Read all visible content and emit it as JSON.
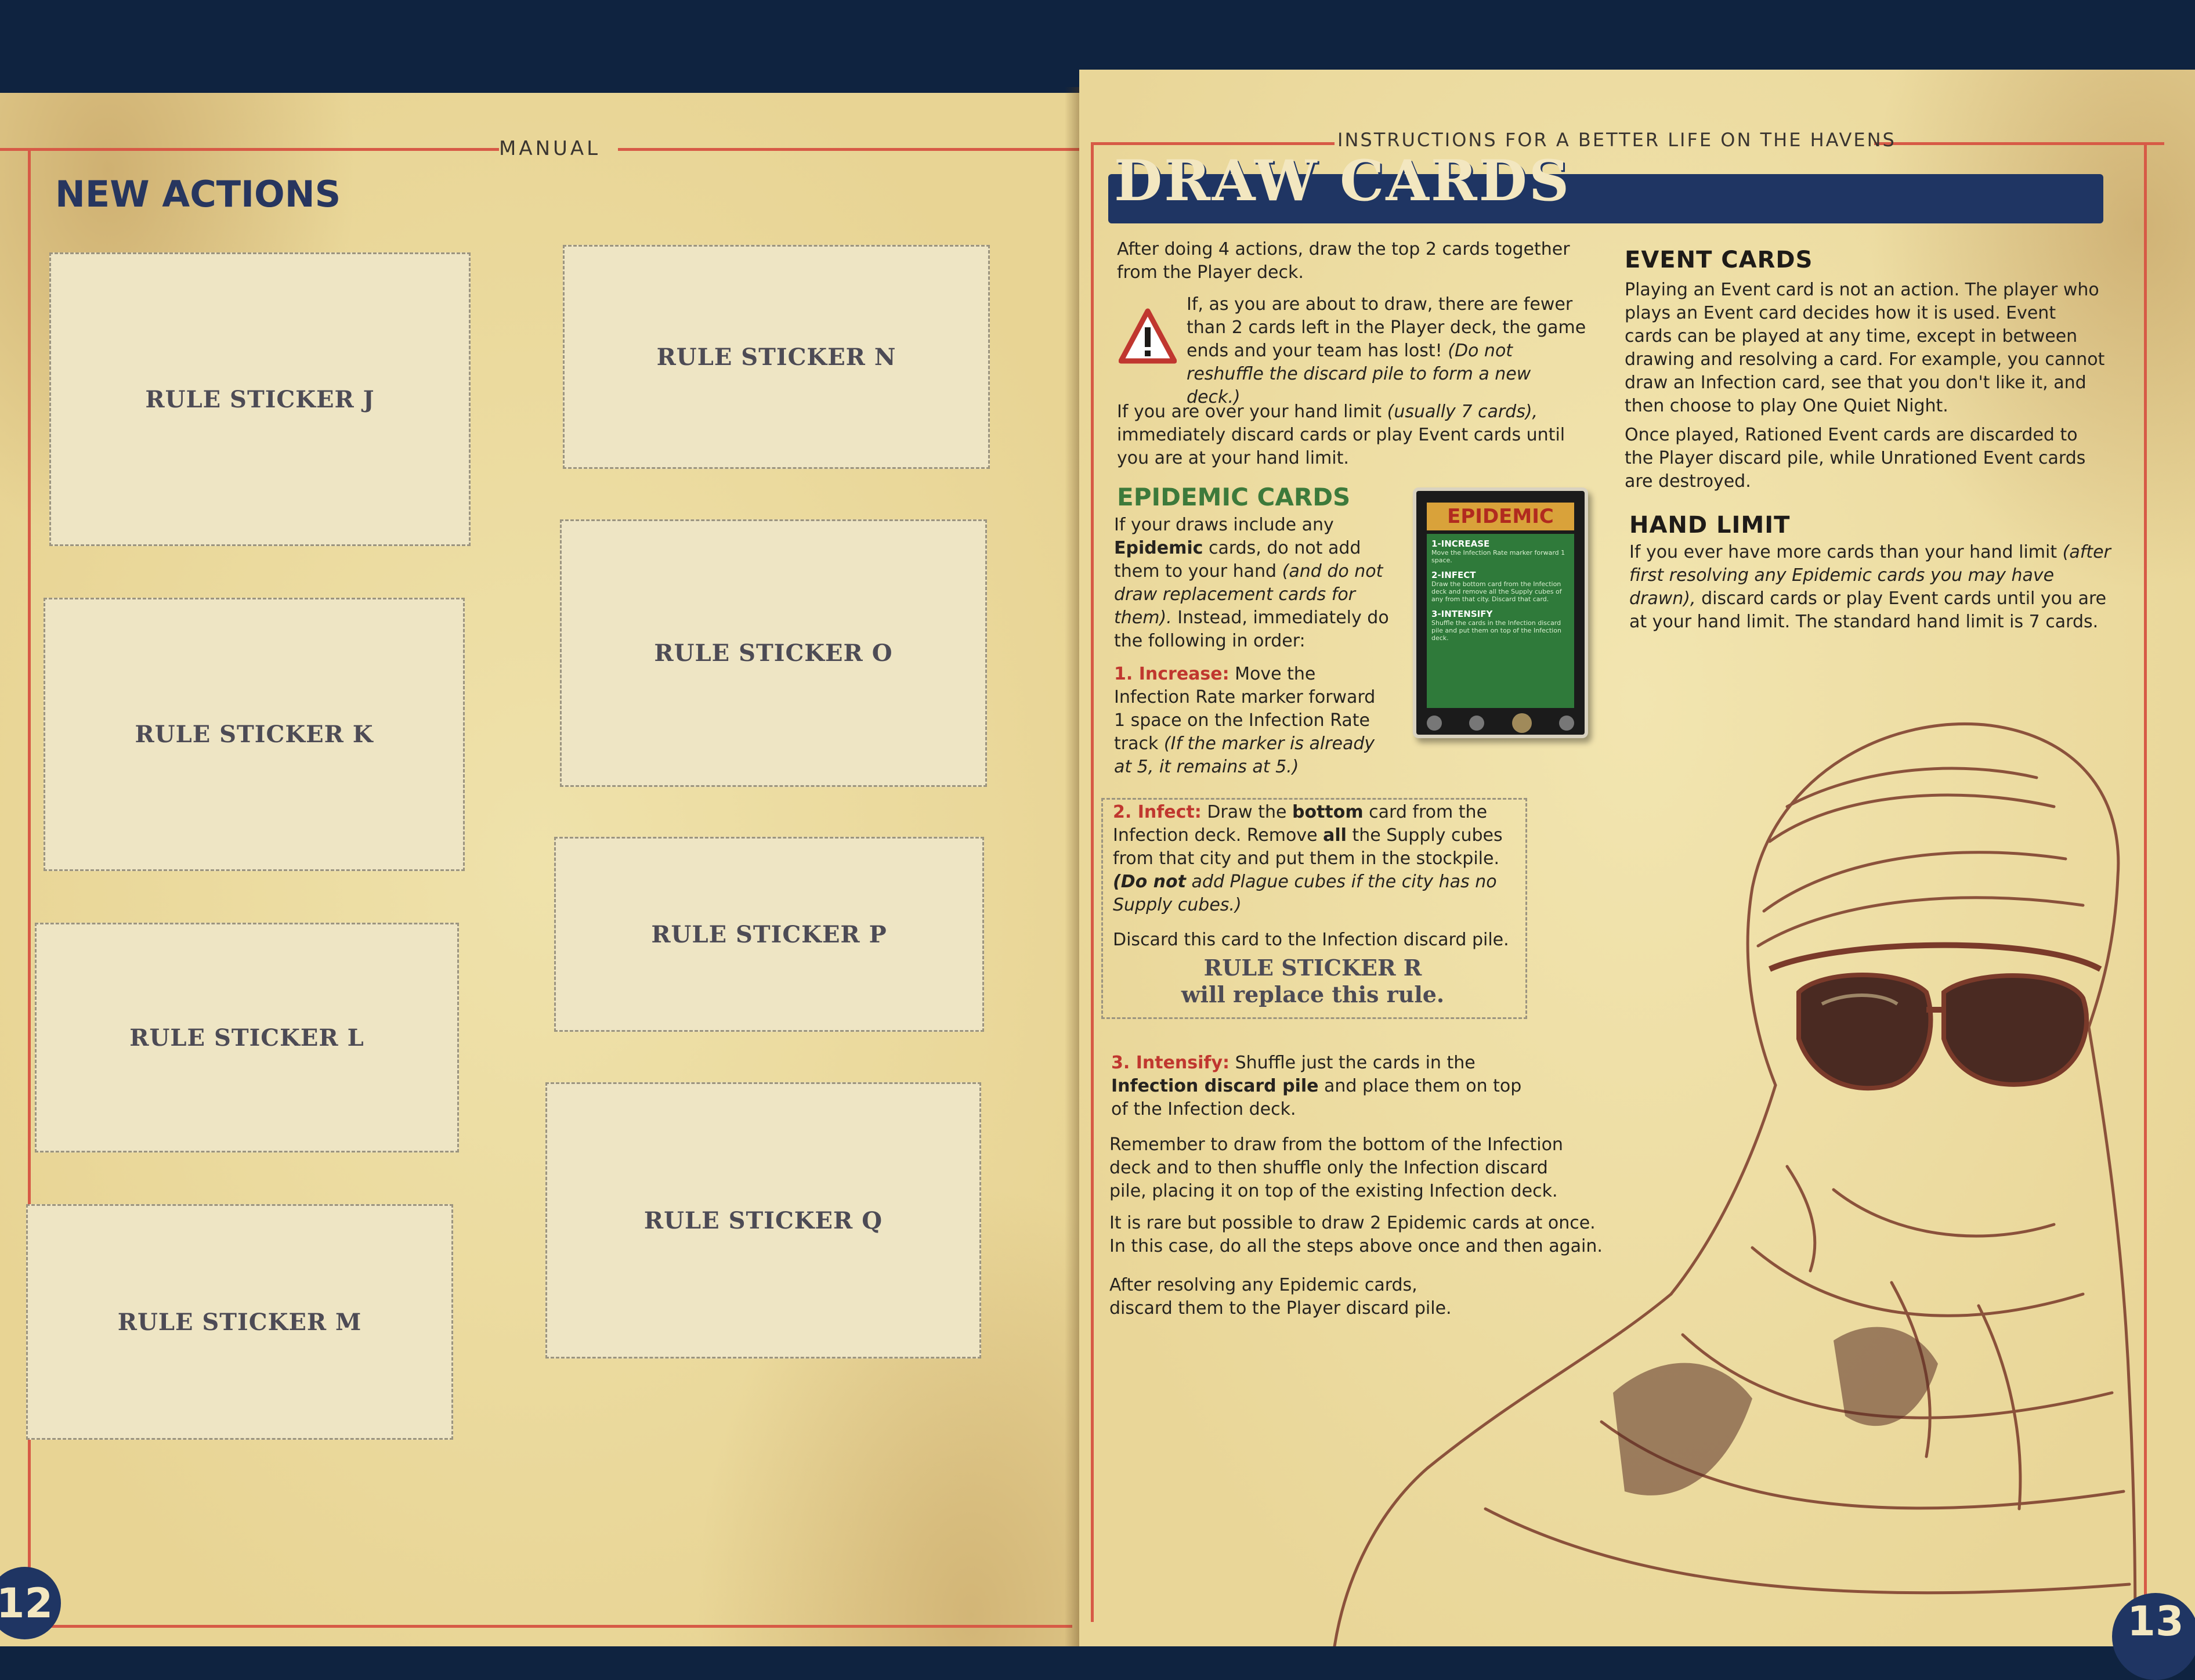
{
  "left_page": {
    "running_head": "MANUAL",
    "title": "NEW ACTIONS",
    "page_number": "12",
    "stickers": [
      "RULE STICKER J",
      "RULE STICKER K",
      "RULE STICKER L",
      "RULE STICKER M",
      "RULE STICKER N",
      "RULE STICKER O",
      "RULE STICKER P",
      "RULE STICKER Q"
    ]
  },
  "right_page": {
    "running_head": "INSTRUCTIONS FOR A BETTER LIFE ON THE HAVENS",
    "title": "DRAW CARDS",
    "page_number": "13",
    "intro": "After doing 4 actions, draw the top 2 cards together from the Player deck.",
    "warning_icon": "warning-triangle-icon",
    "warning_text": "If, as you are about to draw, there are fewer than 2 cards left in the Player deck, the game ends and your team has lost!",
    "warning_note": "(Do not reshuffle the discard pile to form a new deck.)",
    "hand_limit_intro_a": "If you are over your hand limit",
    "hand_limit_intro_b": "(usually 7 cards),",
    "hand_limit_intro_c": "immediately discard cards or play Event cards until you are at your hand limit.",
    "epidemic": {
      "heading": "EPIDEMIC CARDS",
      "p1_a": "If your draws include any",
      "p1_b": "Epidemic",
      "p1_c": "cards, do not add them to your hand",
      "p1_d": "(and do not draw replacement cards for them).",
      "p1_e": "Instead, immediately do the following in order:",
      "step1_label": "1. Increase:",
      "step1_text": "Move the Infection Rate marker forward 1 space on the Infection Rate track",
      "step1_note": "(If the marker is already at 5, it remains at 5.)",
      "step2_label": "2. Infect:",
      "step2_a": "Draw the",
      "step2_b": "bottom",
      "step2_c": "card from the Infection deck. Remove",
      "step2_d": "all",
      "step2_e": "the Supply cubes from that city and put them in the stockpile.",
      "step2_note_a": "(Do not",
      "step2_note_b": "add Plague cubes if the city has no Supply cubes.)",
      "step2_discard": "Discard this card to the Infection discard pile.",
      "sticker_r_line1": "RULE STICKER R",
      "sticker_r_line2": "will replace this rule.",
      "step3_label": "3. Intensify:",
      "step3_a": "Shuffle just the cards in the",
      "step3_b": "Infection discard pile",
      "step3_c": "and place them on top of the Infection deck.",
      "remember": "Remember to draw from the bottom of the Infection deck and to then shuffle only the Infection discard pile, placing it on top of the existing Infection deck.",
      "rare": "It is rare but possible to draw 2 Epidemic cards at once. In this case, do all the steps above once and then again.",
      "after": "After resolving any Epidemic cards, discard them to the Player discard pile."
    },
    "card": {
      "title": "EPIDEMIC",
      "s1_title": "1-INCREASE",
      "s1_text": "Move the Infection Rate marker forward 1 space.",
      "s2_title": "2-INFECT",
      "s2_text": "Draw the bottom card from the Infection deck and remove all the Supply cubes of any from that city. Discard that card.",
      "s3_title": "3-INTENSIFY",
      "s3_text": "Shuffle the cards in the Infection discard pile and put them on top of the Infection deck."
    },
    "event_cards": {
      "heading": "EVENT CARDS",
      "p1": "Playing an Event card is not an action. The player who plays an Event card decides how it is used. Event cards can be played at any time, except in between drawing and resolving a card. For example, you cannot draw an Infection card, see that you don't like it, and then choose to play One Quiet Night.",
      "p2": "Once played, Rationed Event cards are discarded to the Player discard pile, while Unrationed Event cards are destroyed."
    },
    "hand_limit": {
      "heading": "HAND LIMIT",
      "p1_a": "If you ever have more cards than your hand limit",
      "p1_b": "(after first resolving any Epidemic cards you may have drawn),",
      "p1_c": "discard cards or play Event cards until you are at your hand limit. The standard hand limit is 7 cards."
    }
  },
  "colors": {
    "background": "#0f2340",
    "paper": "#ecdc9e",
    "border_red": "#d75a46",
    "navy": "#1f3563",
    "green": "#3d7a3b",
    "step_red": "#c0372f",
    "sketch_brown": "#7a3a2a"
  }
}
